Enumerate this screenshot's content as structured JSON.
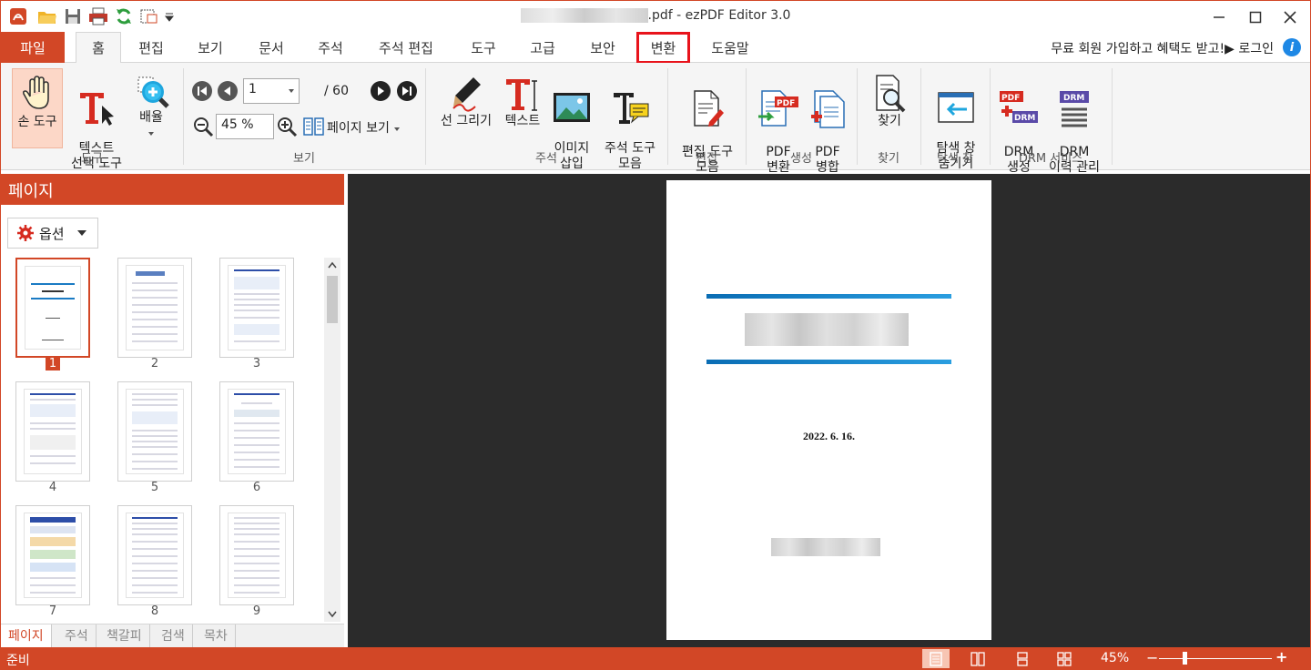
{
  "title": {
    "suffix": ".pdf - ",
    "app": "ezPDF Editor 3.0"
  },
  "tabs": {
    "file": "파일",
    "items": [
      "홈",
      "편집",
      "보기",
      "문서",
      "주석",
      "주석 편집",
      "도구",
      "고급",
      "보안",
      "변환",
      "도움말"
    ],
    "active": "홈",
    "highlighted": "변환"
  },
  "header_right": {
    "signup": "무료 회원 가입하고 혜택도 받고!▶ 로그인"
  },
  "ribbon": {
    "tool_group": {
      "label": "도구",
      "hand": "손 도구",
      "text_select": "텍스트\n선택 도구",
      "zoom": "배율"
    },
    "view_group": {
      "label": "보기",
      "page_value": "1",
      "page_total": "/ 60",
      "zoom_value": "45 %",
      "page_view": "페이지 보기"
    },
    "annot_group": {
      "label": "주석",
      "line_draw": "선 그리기",
      "text": "텍스트",
      "image_insert": "이미지\n삽입",
      "annot_tools": "주석 도구\n모음"
    },
    "edit_group": {
      "label": "편집",
      "edit_tools": "편집 도구\n모음"
    },
    "create_group": {
      "label": "생성",
      "pdf_convert": "PDF\n변환",
      "pdf_merge": "PDF\n병합"
    },
    "find_group": {
      "label": "찾기",
      "find": "찾기"
    },
    "nav_group": {
      "label": "탐색 창",
      "hide_nav": "탐색 창\n숨기기"
    },
    "drm_group": {
      "label": "DRM 서비스",
      "drm_create": "DRM\n생성",
      "drm_history": "DRM\n이력 관리"
    }
  },
  "left_panel": {
    "title": "페이지",
    "options": "옵션",
    "thumbnails": [
      "1",
      "2",
      "3",
      "4",
      "5",
      "6",
      "7",
      "8",
      "9"
    ],
    "selected": "1",
    "bottom_tabs": [
      "페이지",
      "주석",
      "책갈피",
      "검색",
      "목차"
    ]
  },
  "document": {
    "date": "2022.  6.  16."
  },
  "status": {
    "text": "준비",
    "zoom": "45%"
  },
  "colors": {
    "accent": "#d24726",
    "highlight": "#e8131b",
    "doc_bar": "#0a6db4"
  }
}
